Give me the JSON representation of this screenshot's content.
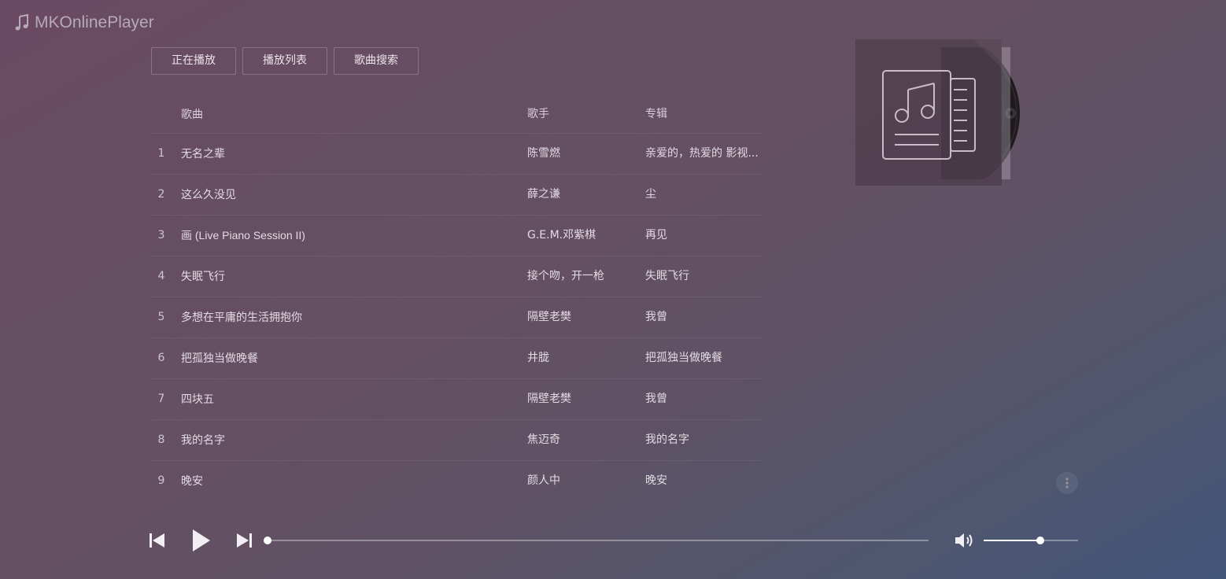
{
  "app": {
    "title": "MKOnlinePlayer"
  },
  "tabs": [
    {
      "label": "正在播放"
    },
    {
      "label": "播放列表"
    },
    {
      "label": "歌曲搜索"
    }
  ],
  "list": {
    "columns": {
      "title": "歌曲",
      "artist": "歌手",
      "album": "专辑"
    },
    "rows": [
      {
        "num": "1",
        "title": "无名之辈",
        "artist": "陈雪燃",
        "album": "亲爱的，热爱的 影视..."
      },
      {
        "num": "2",
        "title": "这么久没见",
        "artist": "薛之谦",
        "album": "尘"
      },
      {
        "num": "3",
        "title": "画 (Live Piano Session II)",
        "artist": "G.E.M.邓紫棋",
        "album": "再见"
      },
      {
        "num": "4",
        "title": "失眠飞行",
        "artist": "接个吻，开一枪",
        "album": "失眠飞行"
      },
      {
        "num": "5",
        "title": "多想在平庸的生活拥抱你",
        "artist": "隔壁老樊",
        "album": "我曾"
      },
      {
        "num": "6",
        "title": "把孤独当做晚餐",
        "artist": "井胧",
        "album": "把孤独当做晚餐"
      },
      {
        "num": "7",
        "title": "四块五",
        "artist": "隔壁老樊",
        "album": "我曾"
      },
      {
        "num": "8",
        "title": "我的名字",
        "artist": "焦迈奇",
        "album": "我的名字"
      },
      {
        "num": "9",
        "title": "晚安",
        "artist": "颜人中",
        "album": "晚安"
      }
    ]
  },
  "player": {
    "progress_fraction": 0.0,
    "volume_fraction": 0.6
  },
  "icons": {
    "logo": "music-note-icon",
    "cover": "music-document-icon",
    "prev": "skip-previous-icon",
    "play": "play-icon",
    "next": "skip-next-icon",
    "volume": "volume-icon",
    "more": "more-vertical-icon"
  }
}
